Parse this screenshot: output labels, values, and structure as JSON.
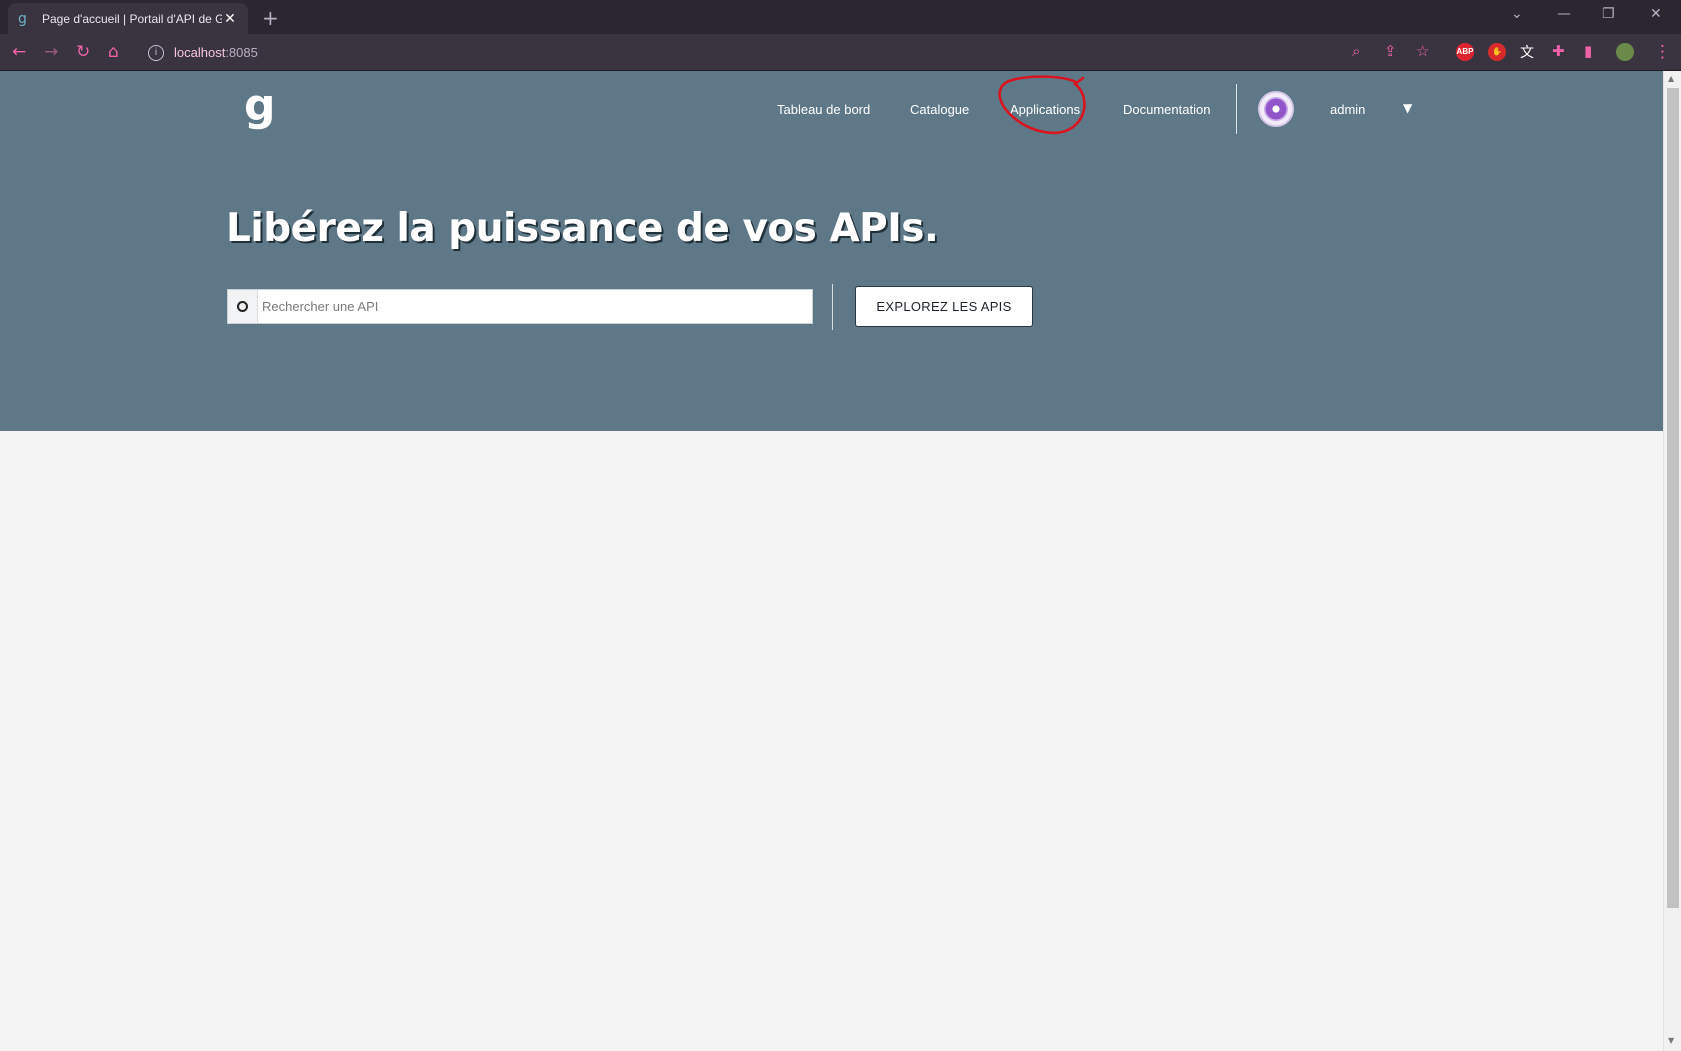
{
  "browser": {
    "tab_title": "Page d'accueil | Portail d'API de G",
    "tab_close": "✕",
    "new_tab": "+",
    "url_host": "localhost",
    "url_port": ":8085",
    "ext_abp": "ABP"
  },
  "header": {
    "nav": {
      "dashboard": "Tableau de bord",
      "catalog": "Catalogue",
      "applications": "Applications",
      "documentation": "Documentation"
    },
    "user": "admin"
  },
  "hero": {
    "title": "Libérez la puissance de vos APIs.",
    "search_placeholder": "Rechercher une API",
    "explore_button": "EXPLOREZ LES APIS"
  },
  "colors": {
    "hero_bg": "#5e7887",
    "annotation": "#d9141f"
  }
}
